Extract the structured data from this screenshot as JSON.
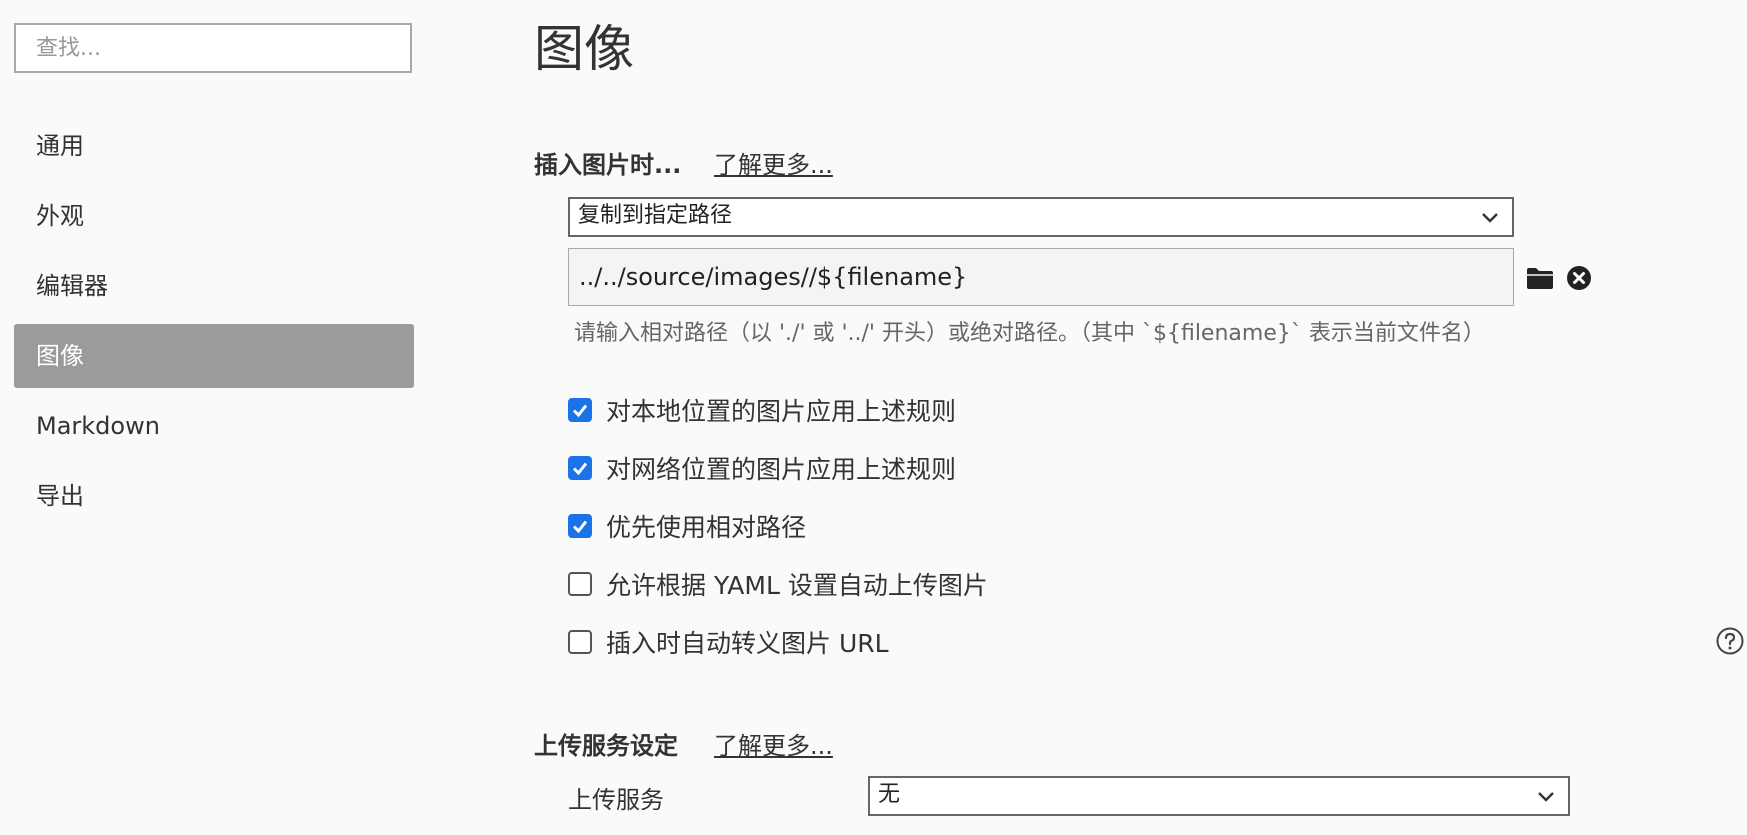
{
  "sidebar": {
    "search_placeholder": "查找...",
    "items": [
      {
        "label": "通用"
      },
      {
        "label": "外观"
      },
      {
        "label": "编辑器"
      },
      {
        "label": "图像",
        "active": true
      },
      {
        "label": "Markdown"
      },
      {
        "label": "导出"
      }
    ]
  },
  "main": {
    "title": "图像",
    "insert_section": {
      "header": "插入图片时...",
      "learn_more": "了解更多...",
      "action_select": "复制到指定路径",
      "path_value": "../../source/images//${filename}",
      "hint": "请输入相对路径（以 './' 或 '../' 开头）或绝对路径。（其中 `${filename}` 表示当前文件名）",
      "options": [
        {
          "label": "对本地位置的图片应用上述规则",
          "checked": true
        },
        {
          "label": "对网络位置的图片应用上述规则",
          "checked": true
        },
        {
          "label": "优先使用相对路径",
          "checked": true
        },
        {
          "label": "允许根据 YAML 设置自动上传图片",
          "checked": false
        },
        {
          "label": "插入时自动转义图片 URL",
          "checked": false
        }
      ]
    },
    "upload_section": {
      "header": "上传服务设定",
      "learn_more": "了解更多...",
      "service_label": "上传服务",
      "service_value": "无"
    }
  },
  "colors": {
    "active_nav_bg": "#9b9b9b",
    "checkbox_accent": "#1a73e8",
    "background": "#fafafa"
  },
  "icons": [
    "folder-icon",
    "clear-icon",
    "help-icon",
    "chevron-down-icon"
  ]
}
